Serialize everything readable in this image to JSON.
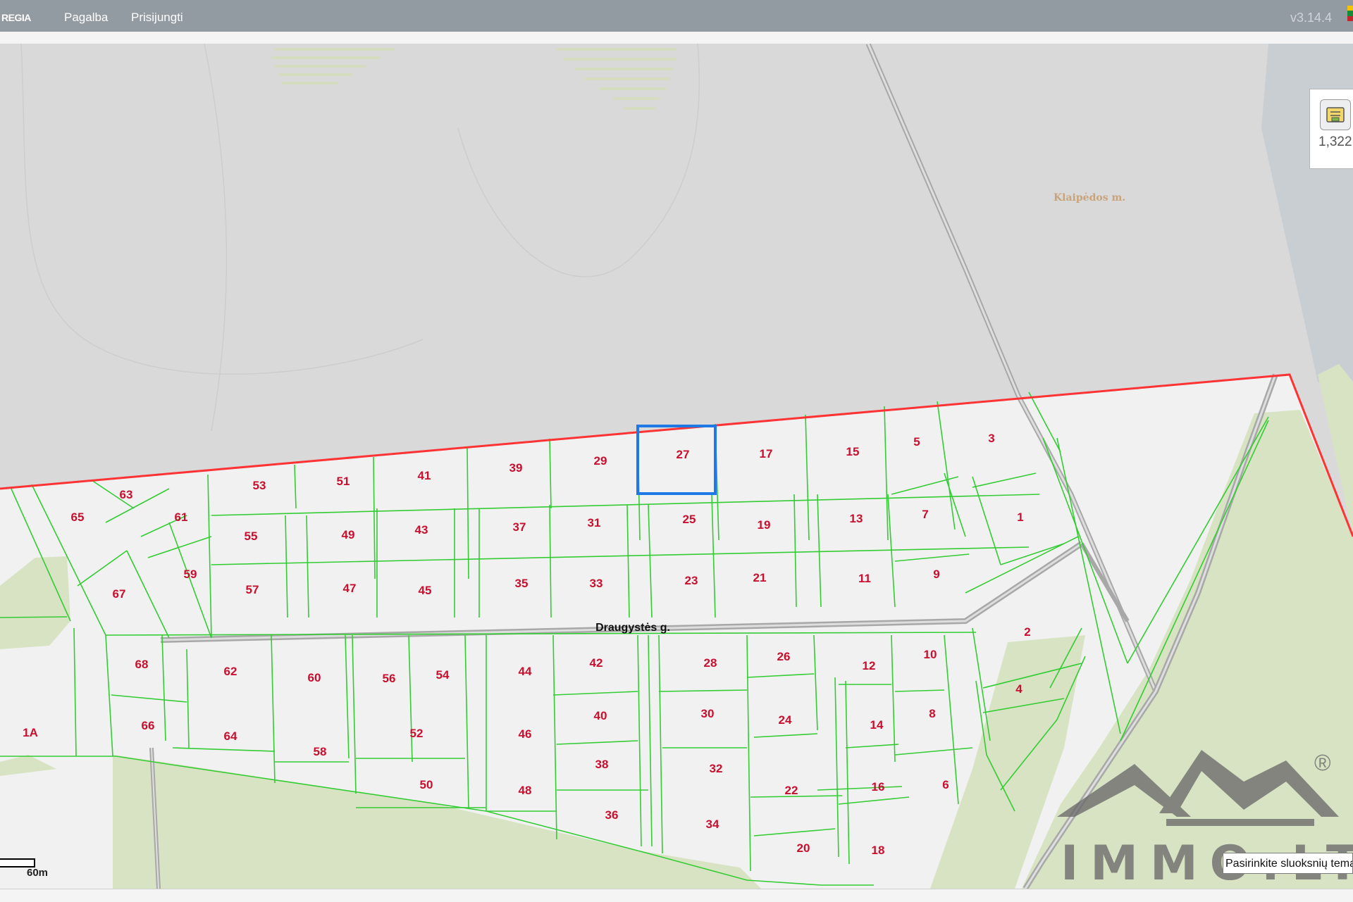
{
  "topbar": {
    "brand": "REGIA",
    "menu": [
      "Pagalba",
      "Prisijungti"
    ],
    "version": "v3.14.4"
  },
  "map": {
    "city_label": "Klaipėdos m.",
    "street_label": "Draugystės g.",
    "selected_lot": "27",
    "colors": {
      "parcel_border": "#33cc33",
      "boundary": "#ff3333",
      "selection": "#1e78e6",
      "lot_label": "#c8102e",
      "forest": "#d8e3c3"
    },
    "lots": [
      "1",
      "1A",
      "2",
      "3",
      "4",
      "5",
      "6",
      "7",
      "8",
      "9",
      "10",
      "11",
      "12",
      "13",
      "14",
      "15",
      "16",
      "17",
      "18",
      "19",
      "20",
      "21",
      "22",
      "23",
      "24",
      "25",
      "26",
      "27",
      "28",
      "29",
      "30",
      "31",
      "32",
      "33",
      "34",
      "35",
      "36",
      "37",
      "38",
      "39",
      "40",
      "41",
      "42",
      "43",
      "44",
      "45",
      "46",
      "47",
      "48",
      "49",
      "50",
      "51",
      "52",
      "53",
      "54",
      "55",
      "56",
      "57",
      "58",
      "59",
      "60",
      "61",
      "62",
      "63",
      "64",
      "65",
      "66",
      "67",
      "68"
    ]
  },
  "zoom_panel": {
    "scale_value": "1,322",
    "icon": "print-map-icon"
  },
  "scale_bar": {
    "label": "60m"
  },
  "layer_select": {
    "text": "Pasirinkite sluoksnių tema"
  },
  "watermark": {
    "text": "IMMO.LT",
    "mark": "®"
  }
}
